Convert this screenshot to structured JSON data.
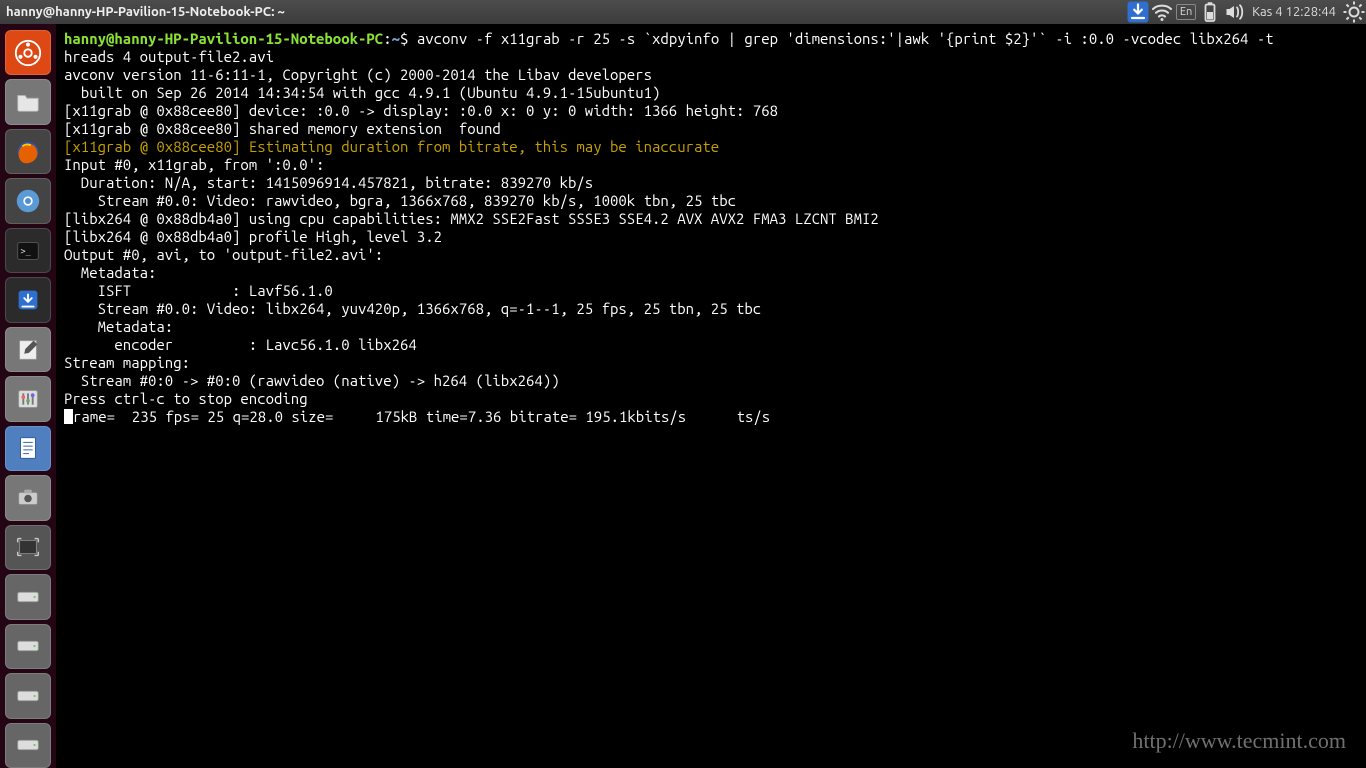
{
  "topbar": {
    "title": "hanny@hanny-HP-Pavilion-15-Notebook-PC: ~",
    "lang": "En",
    "clock": "Kas 4 12:28:44"
  },
  "launcher": {
    "items": [
      {
        "name": "ubuntu-dash",
        "bg": "#dd4814"
      },
      {
        "name": "files",
        "bg": "#6f6f6f"
      },
      {
        "name": "firefox",
        "bg": "#3a3a3a"
      },
      {
        "name": "chromium",
        "bg": "#3a3a3a"
      },
      {
        "name": "terminal",
        "bg": "#2b2b2b"
      },
      {
        "name": "downloader",
        "bg": "#2b2b2b"
      },
      {
        "name": "text-editor",
        "bg": "#6f6f6f"
      },
      {
        "name": "settings",
        "bg": "#6f6f6f"
      },
      {
        "name": "libreoffice-writer",
        "bg": "#3a6ea5"
      },
      {
        "name": "shotwell",
        "bg": "#6f6f6f"
      },
      {
        "name": "screenshot",
        "bg": "#6f6f6f"
      },
      {
        "name": "disk-1",
        "bg": "#5a5a5a"
      },
      {
        "name": "disk-2",
        "bg": "#5a5a5a"
      },
      {
        "name": "disk-3",
        "bg": "#5a5a5a"
      },
      {
        "name": "disk-4",
        "bg": "#5a5a5a"
      }
    ]
  },
  "prompt": {
    "userhost": "hanny@hanny-HP-Pavilion-15-Notebook-PC",
    "path": "~",
    "sep1": ":",
    "sep2": "$ "
  },
  "term": {
    "cmd1": "avconv -f x11grab -r 25 -s `xdpyinfo | grep 'dimensions:'|awk '{print $2}'` -i :0.0 -vcodec libx264 -t",
    "cmd2": "hreads 4 output-file2.avi",
    "l1": "avconv version 11-6:11-1, Copyright (c) 2000-2014 the Libav developers",
    "l2": "  built on Sep 26 2014 14:34:54 with gcc 4.9.1 (Ubuntu 4.9.1-15ubuntu1)",
    "l3": "[x11grab @ 0x88cee80] device: :0.0 -> display: :0.0 x: 0 y: 0 width: 1366 height: 768",
    "l4": "[x11grab @ 0x88cee80] shared memory extension  found",
    "l5": "[x11grab @ 0x88cee80] Estimating duration from bitrate, this may be inaccurate",
    "l6": "Input #0, x11grab, from ':0.0':",
    "l7": "  Duration: N/A, start: 1415096914.457821, bitrate: 839270 kb/s",
    "l8": "    Stream #0.0: Video: rawvideo, bgra, 1366x768, 839270 kb/s, 1000k tbn, 25 tbc",
    "l9": "[libx264 @ 0x88db4a0] using cpu capabilities: MMX2 SSE2Fast SSSE3 SSE4.2 AVX AVX2 FMA3 LZCNT BMI2",
    "l10": "[libx264 @ 0x88db4a0] profile High, level 3.2",
    "l11": "Output #0, avi, to 'output-file2.avi':",
    "l12": "  Metadata:",
    "l13": "    ISFT            : Lavf56.1.0",
    "l14": "    Stream #0.0: Video: libx264, yuv420p, 1366x768, q=-1--1, 25 fps, 25 tbn, 25 tbc",
    "l15": "    Metadata:",
    "l16": "      encoder         : Lavc56.1.0 libx264",
    "l17": "Stream mapping:",
    "l18": "  Stream #0:0 -> #0:0 (rawvideo (native) -> h264 (libx264))",
    "l19": "Press ctrl-c to stop encoding",
    "l20a": "f",
    "l20b": "rame=  235 fps= 25 q=28.0 size=     175kB time=7.36 bitrate= 195.1kbits/s      ts/s"
  },
  "watermark": "http://www.tecmint.com"
}
